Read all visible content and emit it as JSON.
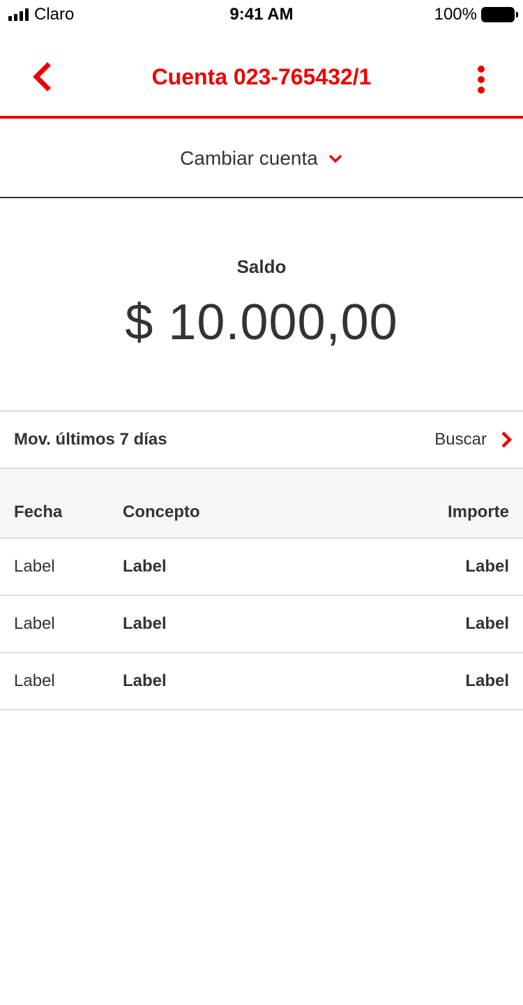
{
  "status_bar": {
    "carrier": "Claro",
    "time": "9:41 AM",
    "battery": "100%"
  },
  "header": {
    "title": "Cuenta 023-765432/1",
    "back_icon": "chevron-left-icon",
    "menu_icon": "more-vertical-icon"
  },
  "account_switcher": {
    "label": "Cambiar cuenta",
    "icon": "chevron-down-icon"
  },
  "balance": {
    "label": "Saldo",
    "amount": "$ 10.000,00"
  },
  "movements": {
    "label": "Mov. últimos 7 días",
    "search_label": "Buscar",
    "search_icon": "chevron-right-icon"
  },
  "table": {
    "headers": {
      "date": "Fecha",
      "concept": "Concepto",
      "amount": "Importe"
    },
    "rows": [
      {
        "date": "Label",
        "concept": "Label",
        "amount": "Label"
      },
      {
        "date": "Label",
        "concept": "Label",
        "amount": "Label"
      },
      {
        "date": "Label",
        "concept": "Label",
        "amount": "Label"
      }
    ]
  },
  "colors": {
    "accent": "#ec0000",
    "text": "#333333",
    "divider": "#dcdcdc",
    "table_header_bg": "#f7f7f7"
  }
}
